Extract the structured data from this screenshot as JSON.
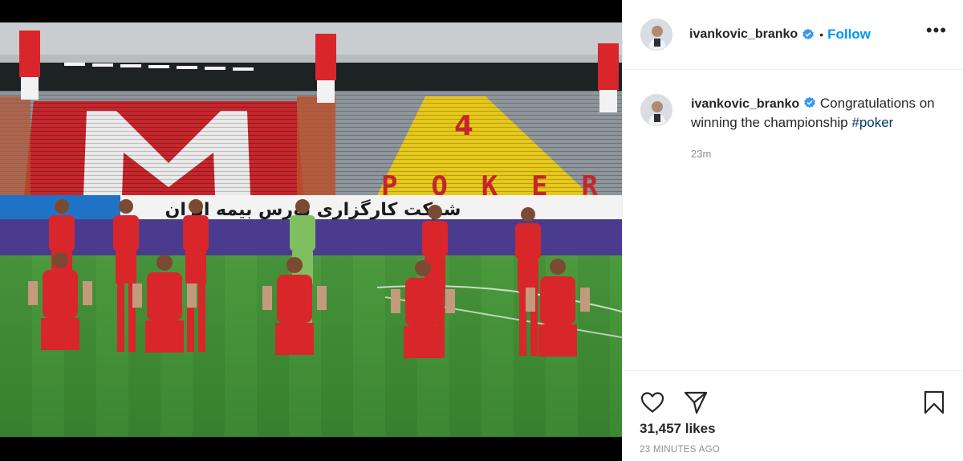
{
  "post": {
    "author": {
      "username": "ivankovic_branko",
      "verified": true,
      "verified_icon": "verified-badge-icon",
      "follow_label": "Follow",
      "separator": "•"
    },
    "more_icon": "more-options-icon",
    "more_label": "•••",
    "caption": {
      "username": "ivankovic_branko",
      "text": "Congratulations on winning the championship",
      "hashtag": "#poker",
      "time": "23m"
    },
    "actions": {
      "like_icon": "heart-icon",
      "share_icon": "send-icon",
      "save_icon": "bookmark-icon"
    },
    "likes": "31,457 likes",
    "timestamp": "23 MINUTES AGO"
  },
  "photo": {
    "stand_left_letter": "M",
    "stand_right_number": "4",
    "stand_right_text": "POKER",
    "banner_text": "شرکت کارگزاری بورس بیمه ایران",
    "colors": {
      "kit_red": "#d8262b",
      "grass": "#3f8a34",
      "stand_yellow": "#e6c81a"
    }
  },
  "colors": {
    "link_blue": "#0095f6",
    "hashtag": "#00376b",
    "text": "#262626",
    "muted": "#8e8e8e"
  }
}
